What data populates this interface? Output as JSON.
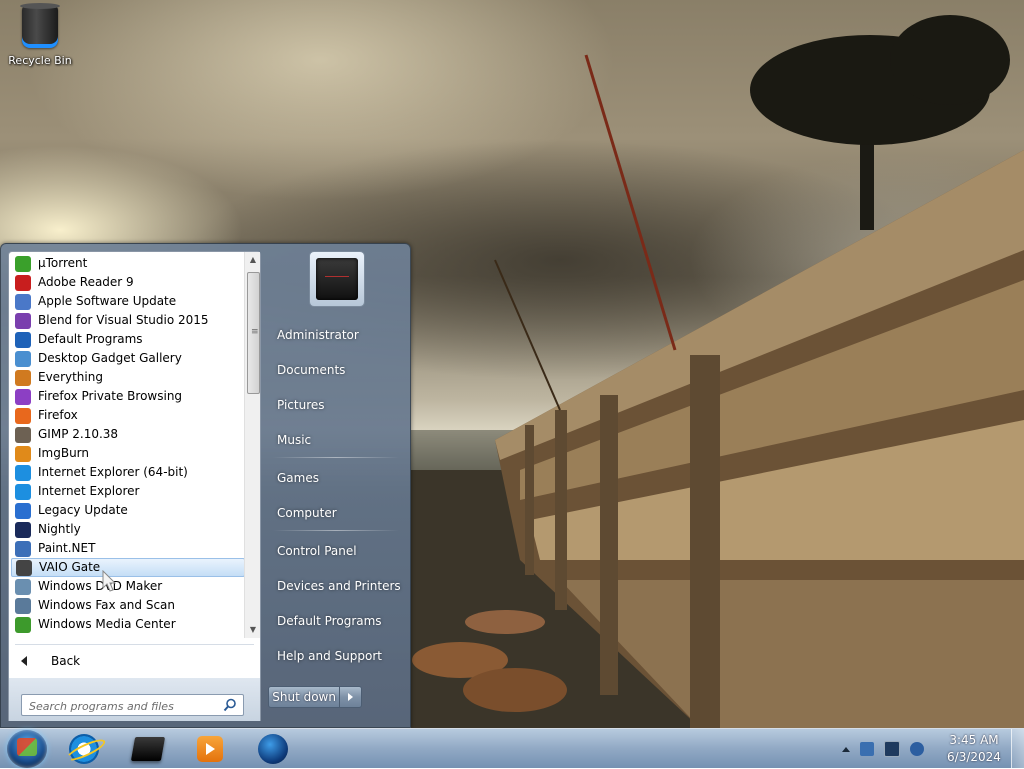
{
  "desktop": {
    "icons": [
      {
        "label": "Recycle Bin",
        "icon": "recycle-bin-icon"
      }
    ]
  },
  "start_menu": {
    "programs": [
      {
        "label": "µTorrent",
        "icon": "utorrent-icon",
        "color": "#3aa02b"
      },
      {
        "label": "Adobe Reader 9",
        "icon": "adobe-reader-icon",
        "color": "#c81e1e"
      },
      {
        "label": "Apple Software Update",
        "icon": "apple-update-icon",
        "color": "#4a78c8"
      },
      {
        "label": "Blend for Visual Studio 2015",
        "icon": "blend-icon",
        "color": "#7a3fae"
      },
      {
        "label": "Default Programs",
        "icon": "default-programs-icon",
        "color": "#1e62b8"
      },
      {
        "label": "Desktop Gadget Gallery",
        "icon": "gadget-gallery-icon",
        "color": "#4a8fd0"
      },
      {
        "label": "Everything",
        "icon": "everything-icon",
        "color": "#d07a20"
      },
      {
        "label": "Firefox Private Browsing",
        "icon": "firefox-private-icon",
        "color": "#8c3fc4"
      },
      {
        "label": "Firefox",
        "icon": "firefox-icon",
        "color": "#e8681d"
      },
      {
        "label": "GIMP 2.10.38",
        "icon": "gimp-icon",
        "color": "#6d6153"
      },
      {
        "label": "ImgBurn",
        "icon": "imgburn-icon",
        "color": "#e08a1a"
      },
      {
        "label": "Internet Explorer (64-bit)",
        "icon": "internet-explorer-icon",
        "color": "#1d8fe0"
      },
      {
        "label": "Internet Explorer",
        "icon": "internet-explorer-icon",
        "color": "#1d8fe0"
      },
      {
        "label": "Legacy Update",
        "icon": "legacy-update-icon",
        "color": "#2a6fd0"
      },
      {
        "label": "Nightly",
        "icon": "nightly-icon",
        "color": "#1a2a5a"
      },
      {
        "label": "Paint.NET",
        "icon": "paint-net-icon",
        "color": "#3c6fb8"
      },
      {
        "label": "VAIO Gate",
        "icon": "vaio-gate-icon",
        "color": "#444444"
      },
      {
        "label": "Windows DVD Maker",
        "icon": "dvd-maker-icon",
        "color": "#6a8fb0"
      },
      {
        "label": "Windows Fax and Scan",
        "icon": "fax-scan-icon",
        "color": "#5a7a9a"
      },
      {
        "label": "Windows Media Center",
        "icon": "media-center-icon",
        "color": "#3d9a2c"
      }
    ],
    "highlighted_program": "VAIO Gate",
    "back_label": "Back",
    "search_placeholder": "Search programs and files",
    "right_items": [
      {
        "label": "Administrator"
      },
      {
        "label": "Documents"
      },
      {
        "label": "Pictures"
      },
      {
        "label": "Music"
      },
      {
        "label": "Games"
      },
      {
        "label": "Computer"
      },
      {
        "label": "Control Panel"
      },
      {
        "label": "Devices and Printers"
      },
      {
        "label": "Default Programs"
      },
      {
        "label": "Help and Support"
      }
    ],
    "shutdown_label": "Shut down"
  },
  "taskbar": {
    "pinned": [
      {
        "icon": "internet-explorer-icon"
      },
      {
        "icon": "vaio-icon"
      },
      {
        "icon": "media-player-icon"
      },
      {
        "icon": "browser-globe-icon"
      }
    ],
    "tray_icons": [
      "network-icon",
      "display-icon",
      "volume-icon"
    ],
    "time": "3:45 AM",
    "date": "6/3/2024"
  }
}
